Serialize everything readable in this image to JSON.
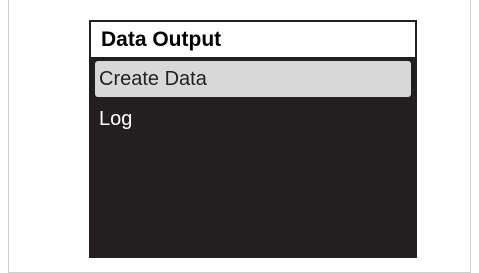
{
  "screen": {
    "title": "Data Output",
    "menu": [
      {
        "label": "Create Data",
        "selected": true
      },
      {
        "label": "Log",
        "selected": false
      }
    ]
  },
  "colors": {
    "screen_background": "#231f20",
    "title_background": "#ffffff",
    "selection_highlight": "#d8d8d8",
    "menu_text": "#ffffff"
  }
}
